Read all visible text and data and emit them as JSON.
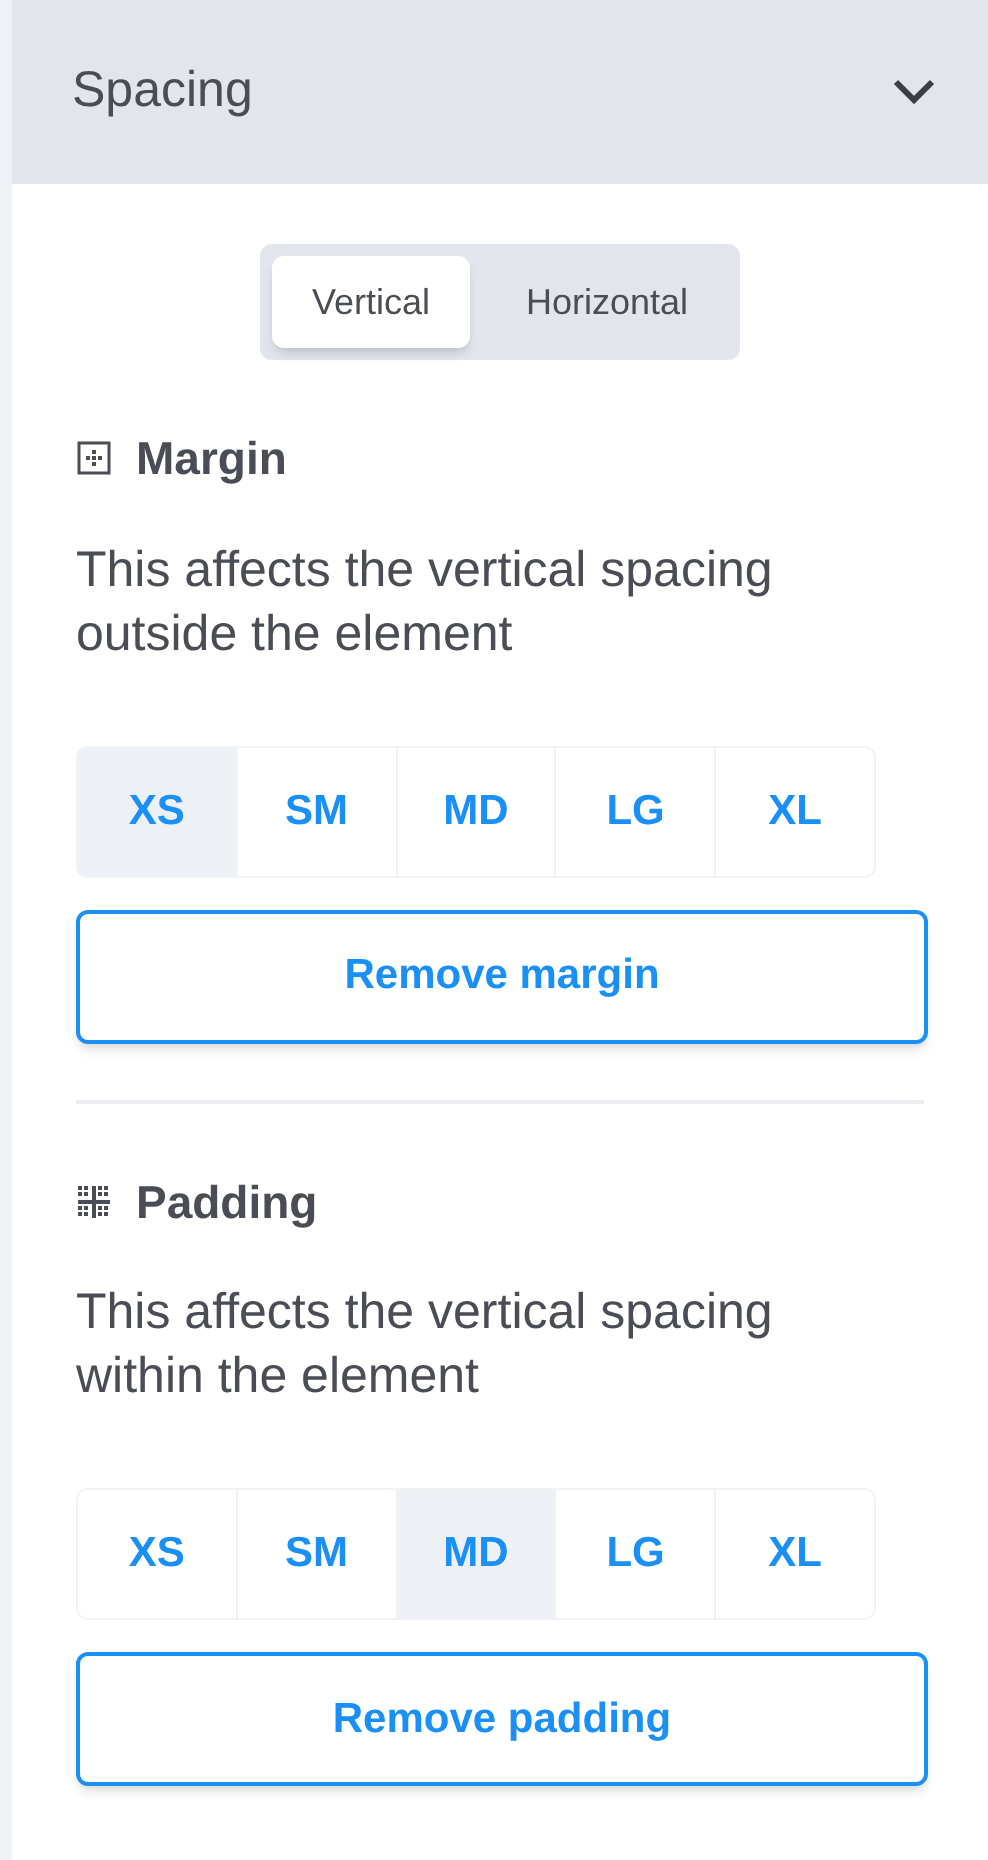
{
  "header": {
    "title": "Spacing",
    "expanded": true
  },
  "direction_tabs": [
    {
      "label": "Vertical",
      "selected": true
    },
    {
      "label": "Horizontal",
      "selected": false
    }
  ],
  "sections": [
    {
      "kind": "margin",
      "title": "Margin",
      "description": "This affects the vertical spacing outside the element",
      "sizes": [
        {
          "label": "XS",
          "selected": true
        },
        {
          "label": "SM",
          "selected": false
        },
        {
          "label": "MD",
          "selected": false
        },
        {
          "label": "LG",
          "selected": false
        },
        {
          "label": "XL",
          "selected": false
        }
      ],
      "remove_button": "Remove margin"
    },
    {
      "kind": "padding",
      "title": "Padding",
      "description": "This affects the vertical spacing within the element",
      "sizes": [
        {
          "label": "XS",
          "selected": false
        },
        {
          "label": "SM",
          "selected": false
        },
        {
          "label": "MD",
          "selected": true
        },
        {
          "label": "LG",
          "selected": false
        },
        {
          "label": "XL",
          "selected": false
        }
      ],
      "remove_button": "Remove padding"
    }
  ]
}
